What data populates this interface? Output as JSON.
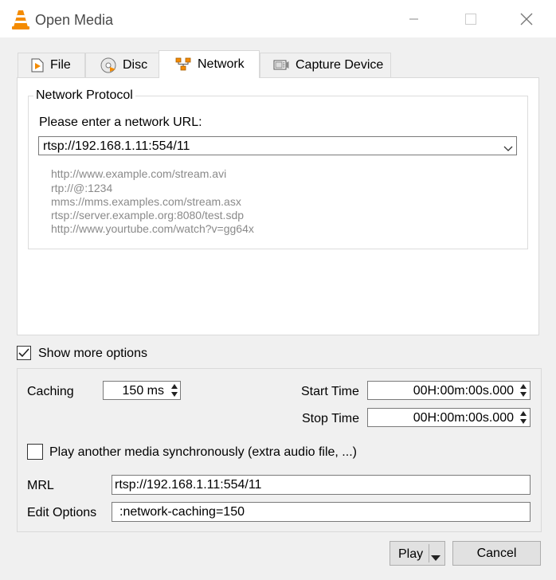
{
  "window": {
    "title": "Open Media"
  },
  "tabs": [
    {
      "label": "File",
      "icon": "file-icon"
    },
    {
      "label": "Disc",
      "icon": "disc-icon"
    },
    {
      "label": "Network",
      "icon": "network-icon",
      "active": true
    },
    {
      "label": "Capture Device",
      "icon": "capture-device-icon"
    }
  ],
  "network": {
    "group_title": "Network Protocol",
    "prompt": "Please enter a network URL:",
    "url_value": "rtsp://192.168.1.11:554/11",
    "examples": [
      "http://www.example.com/stream.avi",
      "rtp://@:1234",
      "mms://mms.examples.com/stream.asx",
      "rtsp://server.example.org:8080/test.sdp",
      "http://www.yourtube.com/watch?v=gg64x"
    ]
  },
  "show_more": {
    "label": "Show more options",
    "checked": true
  },
  "options": {
    "caching_label": "Caching",
    "caching_value": "150 ms",
    "start_time_label": "Start Time",
    "start_time_value": "00H:00m:00s.000",
    "stop_time_label": "Stop Time",
    "stop_time_value": "00H:00m:00s.000",
    "play_sync_label": "Play another media synchronously (extra audio file, ...)",
    "play_sync_checked": false,
    "mrl_label": "MRL",
    "mrl_value": "rtsp://192.168.1.11:554/11",
    "edit_options_label": "Edit Options",
    "edit_options_value": ":network-caching=150"
  },
  "buttons": {
    "play": "Play",
    "cancel": "Cancel"
  },
  "colors": {
    "accent": "#f48b00",
    "background": "#f0f0f0"
  }
}
